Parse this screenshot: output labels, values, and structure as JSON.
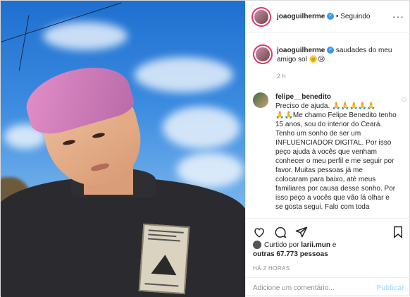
{
  "post": {
    "username": "joaoguilherme",
    "follow_status": "Seguindo",
    "separator": "•",
    "caption": "saudades do meu amigo sol 🌞😢",
    "caption_time": "2 h"
  },
  "comment": {
    "username": "felipe__benedito",
    "text": "Preciso de ajuda. 🙏🙏🙏🙏🙏\n🙏🙏Me chamo Felipe Benedito tenho 15 anos, sou do interior do Ceará. Tenho um sonho de ser um INFLUENCIADOR DIGITAL. Por isso peço ajuda à vocês que venham conhecer o meu perfil e me seguir por favor. Muitas pessoas já me colocaram para baixo, até meus familiares por causa desse sonho. Por isso peço a vocês que vão lá olhar e se gosta segui. Falo com toda"
  },
  "likes": {
    "prefix": "Curtido por",
    "liker": "larii.mun",
    "conj": "e",
    "others": "outras 67.773 pessoas"
  },
  "timestamp": "HÁ 2 HORAS",
  "add_comment": {
    "placeholder": "Adicione um comentário...",
    "publish": "Publicar"
  },
  "colors": {
    "accent": "#3897f0",
    "publish_disabled": "#b2dffc",
    "story_ring": "#e0356a"
  },
  "icons": [
    "heart-icon",
    "comment-icon",
    "share-icon",
    "bookmark-icon",
    "more-icon",
    "verified-icon"
  ]
}
